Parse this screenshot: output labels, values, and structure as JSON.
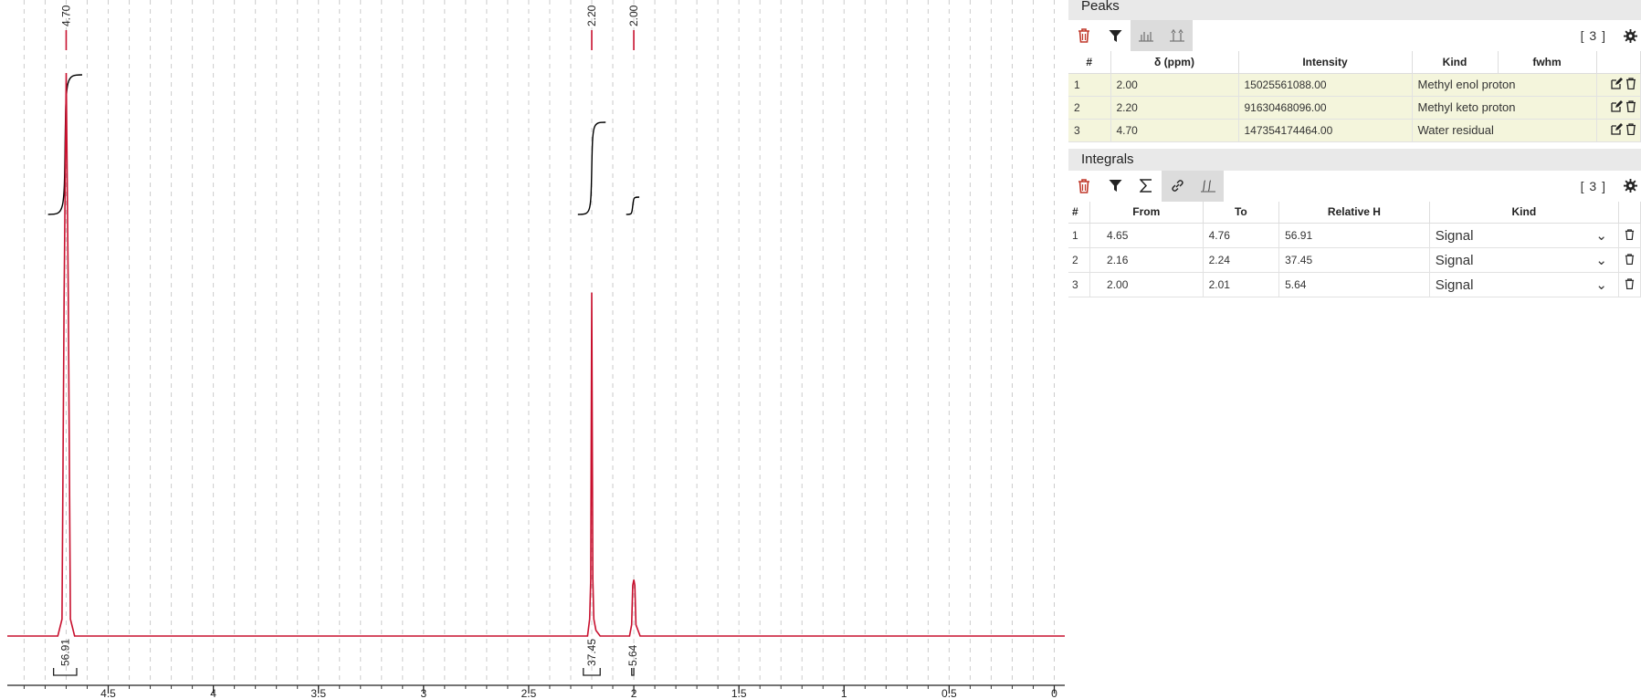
{
  "chart_data": {
    "type": "line",
    "xlabel": "",
    "ylabel": "",
    "xlim": [
      4.98,
      -0.05
    ],
    "x_ticks": [
      "4.5",
      "4",
      "3.5",
      "3",
      "2.5",
      "2",
      "1.5",
      "1",
      "0.5",
      "0"
    ],
    "series": [
      {
        "x": [
          4.98,
          4.74,
          4.72,
          4.71,
          4.7,
          4.69,
          4.68,
          4.66,
          2.35,
          2.22,
          2.21,
          2.205,
          2.2,
          2.195,
          2.19,
          2.18,
          2.16,
          2.09,
          2.02,
          2.01,
          2.005,
          2.0,
          1.995,
          1.99,
          1.97,
          -0.05
        ],
        "y": [
          0,
          0,
          3,
          60,
          100,
          60,
          3,
          0,
          0,
          0,
          3,
          10,
          61,
          10,
          3,
          1,
          0,
          0,
          0,
          2,
          9,
          10,
          9,
          2,
          0,
          0
        ]
      }
    ],
    "peak_labels": [
      {
        "label": "4.70",
        "ppm": 4.7
      },
      {
        "label": "2.20",
        "ppm": 2.2
      },
      {
        "label": "2.00",
        "ppm": 2.0
      }
    ],
    "integrals": [
      {
        "label": "56.91",
        "from": 4.65,
        "to": 4.76
      },
      {
        "label": "37.45",
        "from": 2.16,
        "to": 2.24
      },
      {
        "label": "5.64",
        "from": 2.0,
        "to": 2.01
      }
    ],
    "colors": {
      "spectrum": "#c8102e",
      "integral": "#000000",
      "grid": "#cccccc"
    }
  },
  "peaks": {
    "title": "Peaks",
    "count": "[ 3 ]",
    "columns": [
      "#",
      "δ (ppm)",
      "Intensity",
      "Kind",
      "fwhm"
    ],
    "rows": [
      {
        "n": "1",
        "delta": "2.00",
        "intensity": "15025561088.00",
        "kind": "Methyl enol proton"
      },
      {
        "n": "2",
        "delta": "2.20",
        "intensity": "91630468096.00",
        "kind": "Methyl keto proton"
      },
      {
        "n": "3",
        "delta": "4.70",
        "intensity": "147354174464.00",
        "kind": "Water residual"
      }
    ]
  },
  "integrals_panel": {
    "title": "Integrals",
    "count": "[ 3 ]",
    "columns": [
      "#",
      "From",
      "To",
      "Relative H",
      "Kind"
    ],
    "rows": [
      {
        "n": "1",
        "from": "4.65",
        "to": "4.76",
        "rel": "56.91",
        "kind": "Signal"
      },
      {
        "n": "2",
        "from": "2.16",
        "to": "2.24",
        "rel": "37.45",
        "kind": "Signal"
      },
      {
        "n": "3",
        "from": "2.00",
        "to": "2.01",
        "rel": "5.64",
        "kind": "Signal"
      }
    ]
  },
  "icons": {
    "delete": "trash-icon",
    "filter": "filter-icon",
    "sum": "sigma-icon",
    "link": "link-icon",
    "settings": "gear-icon",
    "edit": "edit-icon"
  }
}
